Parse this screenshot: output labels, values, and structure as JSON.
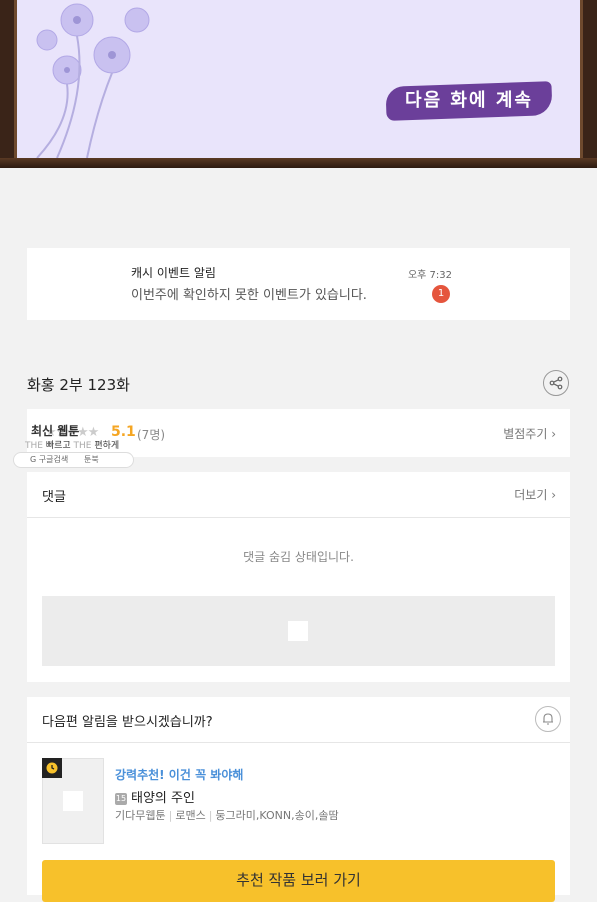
{
  "banner": {
    "caption": "다음 화에 계속"
  },
  "notification": {
    "title": "캐시 이벤트 알림",
    "body": "이번주에 확인하지 못한 이벤트가 있습니다.",
    "time": "오후 7:32",
    "badge": "1"
  },
  "episode": {
    "title": "화홍 2부 123화"
  },
  "rating": {
    "stars": "★★★★★",
    "score": "5.1",
    "count": "(7명)",
    "rate_link": "별점주기 ›"
  },
  "overlay": {
    "title": "최신 웹툰",
    "the1": "THE ",
    "fast": "빠르고 ",
    "the2": "THE ",
    "easy": "편하게",
    "google": "G 구글검색",
    "toonbook": "툰북"
  },
  "comments": {
    "title": "댓글",
    "more": "더보기 ›",
    "hidden_msg": "댓글 숨김 상태입니다."
  },
  "next_episode": {
    "question": "다음편 알림을 받으시겠습니까?",
    "rec_tag": "강력추천! 이건 꼭 봐야해",
    "age_badge": "15",
    "work_title": "태양의 주인",
    "meta": [
      "기다무웹툰",
      "로맨스",
      "둥그라미,KONN,송이,솔땀"
    ],
    "cta": "추천 작품 보러 가기"
  }
}
